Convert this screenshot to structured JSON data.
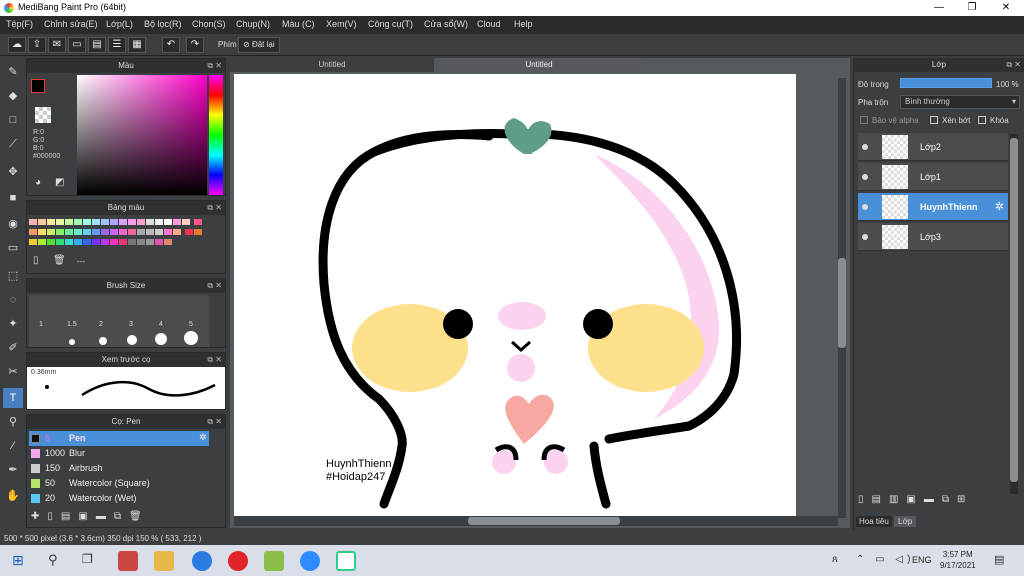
{
  "window": {
    "title": "MediBang Paint Pro (64bit)",
    "minimize": "—",
    "maximize": "❐",
    "close": "✕"
  },
  "menu": [
    "Tệp(F)",
    "Chỉnh sửa(E)",
    "Lớp(L)",
    "Bộ lọc(R)",
    "Chọn(S)",
    "Chụp(N)",
    "Màu (C)",
    "Xem(V)",
    "Công cụ(T)",
    "Cửa sổ(W)",
    "Cloud",
    "Help"
  ],
  "toolbar": {
    "shortcut_label": "Phím",
    "reset_label": "Đặt lại"
  },
  "color_panel": {
    "title": "Màu",
    "r": "R:0",
    "g": "G:0",
    "b": "B:0",
    "hex": "#000000"
  },
  "palette_panel": {
    "title": "Bảng màu",
    "dash": "---"
  },
  "brush_size_panel": {
    "title": "Brush Size",
    "sizes": [
      "1",
      "1.5",
      "2",
      "3",
      "4",
      "5"
    ]
  },
  "preview_panel": {
    "title": "Xem trước cọ",
    "size": "0.36mm"
  },
  "brush_panel": {
    "title": "Cọ: Pen",
    "brushes": [
      {
        "size": "5",
        "name": "Pen",
        "color": "#111111",
        "selected": true
      },
      {
        "size": "1000",
        "name": "Blur",
        "color": "#f1a7e8",
        "selected": false
      },
      {
        "size": "150",
        "name": "Airbrush",
        "color": "#cccccc",
        "selected": false
      },
      {
        "size": "50",
        "name": "Watercolor (Square)",
        "color": "#b6e36a",
        "selected": false
      },
      {
        "size": "20",
        "name": "Watercolor (Wet)",
        "color": "#5bc8f0",
        "selected": false
      }
    ]
  },
  "canvas": {
    "tab1": "Untitled",
    "tab2": "Untitled",
    "signature_line1": "HuynhThienn",
    "signature_line2": "#Hoidap247"
  },
  "layer_panel": {
    "title": "Lớp",
    "opacity_label": "Độ trong",
    "opacity_value": "100 %",
    "blend_label": "Pha trộn",
    "blend_value": "Bình thường",
    "protect_alpha": "Bảo vệ alpha",
    "clipping": "Xén bớt",
    "lock": "Khóa",
    "layers": [
      "Lớp2",
      "Lớp1",
      "HuynhThienn",
      "Lớp3"
    ],
    "tab_nav": "Hoa tiêu",
    "tab_layer": "Lớp"
  },
  "status": {
    "text": "500 * 500 pixel  (3.6 * 3.6cm)  350 dpi  150 %  ( 533, 212 )"
  },
  "taskbar": {
    "lang": "ENG",
    "time": "3:57 PM",
    "date": "9/17/2021"
  },
  "colors": {
    "accent": "#4a90d9",
    "panel": "#3c3f41",
    "dark": "#2b2b2b"
  }
}
